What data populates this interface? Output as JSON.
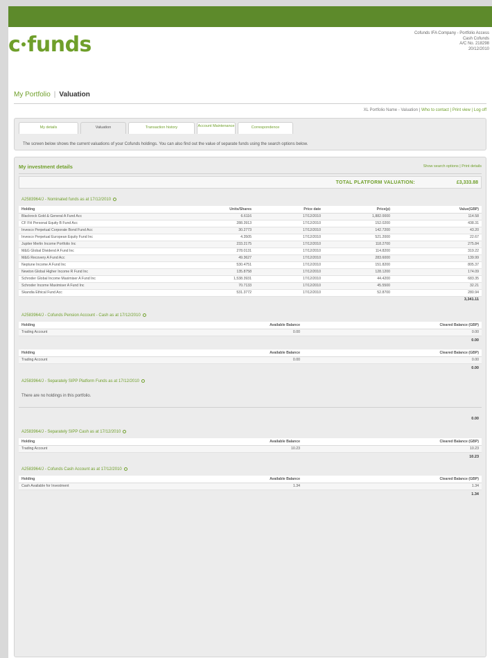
{
  "brand": {
    "logo_left": "c",
    "logo_right": "funds"
  },
  "header": {
    "line1": "Cofunds IFA Company - Portfolio Access",
    "line2": "Cash Cofunds",
    "line3": "A/C No. 218298",
    "line4": "20/12/2010"
  },
  "breadcrumb": {
    "parent": "My Portfolio",
    "current": "Valuation"
  },
  "userbar": {
    "name": "XL Portfolio Name - Valuation",
    "links": "Who to contact | Print view | Log off"
  },
  "tabs": [
    "My details",
    "Valuation",
    "Transaction history",
    "Account Maintenance",
    "Correspondence"
  ],
  "intro": "The screen below shows the current valuations of your Cofunds holdings. You can also find out the value of separate funds using the search options below.",
  "panel": {
    "title": "My investment details",
    "tools": "Show search options  |  Print details",
    "total_label": "TOTAL PLATFORM VALUATION:",
    "total_value": "£3,333.88"
  },
  "sections": [
    {
      "head": "A2583964/J - Nominated funds as at 17/12/2010",
      "cols": [
        "Holding",
        "Units/Shares",
        "Price date",
        "Price(p)",
        "Value(GBP)"
      ],
      "rows": [
        [
          "Blackrock Gold & General A Fund Acc",
          "6.6116",
          "17/12/2010",
          "1,882.0000",
          "114.58"
        ],
        [
          "CF FH Personal Equity B Fund Acc",
          "288.3913",
          "17/12/2010",
          "152.0200",
          "438.31"
        ],
        [
          "Invesco Perpetual Corporate Bond Fund Acc",
          "30.2773",
          "17/12/2010",
          "142.7200",
          "43.20"
        ],
        [
          "Invesco Perpetual European Equity Fund Inc",
          "4.3505",
          "17/12/2010",
          "521.2000",
          "22.67"
        ],
        [
          "Jupiter Merlin Income Portfolio Inc",
          "233.2175",
          "17/12/2010",
          "118.2700",
          "275.84"
        ],
        [
          "M&G Global Dividend A Fund Inc",
          "278.0131",
          "17/12/2010",
          "114.8200",
          "319.22"
        ],
        [
          "M&G Recovery A Fund Acc",
          "49.3627",
          "17/12/2010",
          "283.6000",
          "139.99"
        ],
        [
          "Neptune Income A Fund Inc",
          "530.4751",
          "17/12/2010",
          "151.8200",
          "805.37"
        ],
        [
          "Newton Global Higher Income R Fund Inc",
          "135.8758",
          "17/12/2010",
          "128.1200",
          "174.09"
        ],
        [
          "Schroder Global Income Maximiser A Fund Inc",
          "1,538.3931",
          "17/12/2010",
          "44.4200",
          "683.35"
        ],
        [
          "Schroder Income Maximiser A Fund Inc",
          "70.7133",
          "17/12/2010",
          "45.5500",
          "32.21"
        ],
        [
          "Skandia Ethical Fund Acc",
          "531.3772",
          "17/12/2010",
          "52.8700",
          "280.94"
        ]
      ],
      "subtotal": "3,341.11"
    },
    {
      "head": "A2583964/J - Cofunds Pension Account - Cash as at 17/12/2010",
      "cols": [
        "Holding",
        "Available Balance",
        "Cleared Balance (GBP)"
      ],
      "rows": [
        [
          "Trading Account",
          "0.00",
          "0.00"
        ]
      ],
      "subtotal": "0.00"
    },
    {
      "head": "",
      "cols": [
        "Holding",
        "Available Balance",
        "Cleared Balance (GBP)"
      ],
      "rows": [
        [
          "Trading Account",
          "0.00",
          "0.00"
        ]
      ],
      "subtotal": "0.00"
    },
    {
      "head": "A2583964/J - Separately SIPP Platform Funds as at 17/12/2010",
      "note": "There are no holdings in this portfolio.",
      "subtotal": "0.00"
    },
    {
      "head": "A2583964/J - Separately SIPP Cash as at 17/12/2010",
      "cols": [
        "Holding",
        "Available Balance",
        "Cleared Balance (GBP)"
      ],
      "rows": [
        [
          "Trading Account",
          "10.23",
          "10.23"
        ]
      ],
      "subtotal": "10.23"
    },
    {
      "head": "A2583964/J - Cofunds Cash Account as at 17/12/2010",
      "cols": [
        "Holding",
        "Available Balance",
        "Cleared Balance (GBP)"
      ],
      "rows": [
        [
          "Cash Available for Investment",
          "1.34",
          "1.34"
        ]
      ],
      "subtotal": "1.34"
    }
  ],
  "colors": {
    "brand": "#6f9f2a",
    "topbar": "#5d8a2b"
  }
}
